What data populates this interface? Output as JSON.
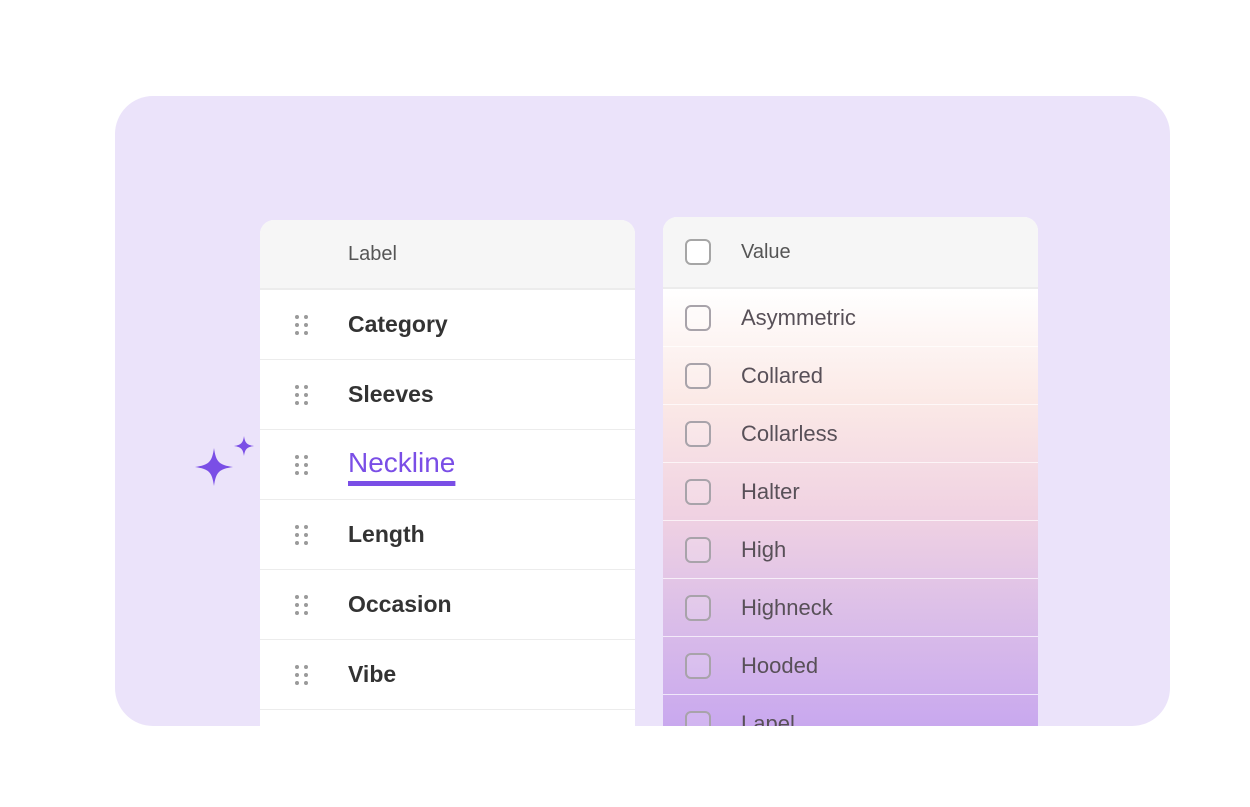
{
  "colors": {
    "background": "#ebe3fa",
    "accent": "#7a4ee6",
    "panel": "#ffffff",
    "header": "#f6f6f6"
  },
  "sparkle": {
    "icon": "sparkle-icon"
  },
  "label_table": {
    "header": "Label",
    "rows": [
      {
        "label": "Category",
        "active": false
      },
      {
        "label": "Sleeves",
        "active": false
      },
      {
        "label": "Neckline",
        "active": true
      },
      {
        "label": "Length",
        "active": false
      },
      {
        "label": "Occasion",
        "active": false
      },
      {
        "label": "Vibe",
        "active": false
      }
    ]
  },
  "value_table": {
    "header": "Value",
    "rows": [
      {
        "value": "Asymmetric",
        "checked": false
      },
      {
        "value": "Collared",
        "checked": false
      },
      {
        "value": "Collarless",
        "checked": false
      },
      {
        "value": "Halter",
        "checked": false
      },
      {
        "value": "High",
        "checked": false
      },
      {
        "value": "Highneck",
        "checked": false
      },
      {
        "value": "Hooded",
        "checked": false
      },
      {
        "value": "Lapel",
        "checked": false
      }
    ]
  }
}
